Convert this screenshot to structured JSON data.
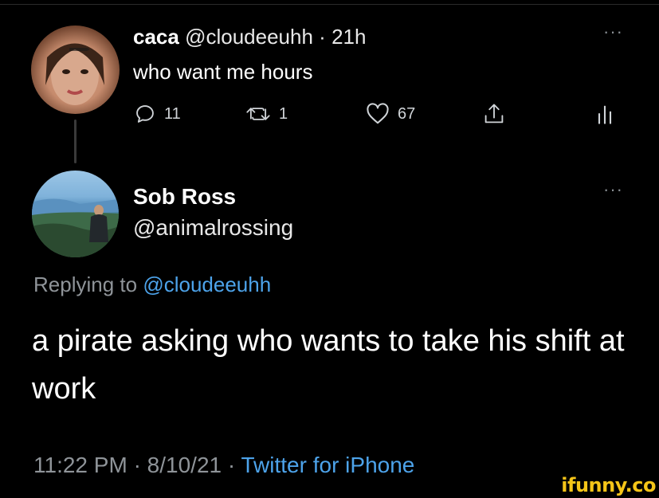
{
  "original_tweet": {
    "name": "caca",
    "handle": "@cloudeeuhh",
    "separator": "·",
    "time": "21h",
    "text": "who want me hours",
    "actions": {
      "reply_count": "11",
      "retweet_count": "1",
      "like_count": "67"
    }
  },
  "reply_tweet": {
    "name": "Sob Ross",
    "handle": "@animalrossing",
    "replying_prefix": "Replying to",
    "replying_mention": "@cloudeeuhh",
    "text": "a pirate asking who wants to take his shift at work",
    "time": "11:22 PM",
    "separator1": "·",
    "date": "8/10/21",
    "separator2": "·",
    "source": "Twitter for iPhone"
  },
  "more_label": "···",
  "watermark": "ifunny.co",
  "colors": {
    "background": "#000000",
    "link": "#4da3ea",
    "muted": "#8f9499",
    "watermark": "#f5c518"
  },
  "icons": [
    "reply-icon",
    "retweet-icon",
    "like-icon",
    "share-icon",
    "analytics-icon",
    "more-icon"
  ]
}
